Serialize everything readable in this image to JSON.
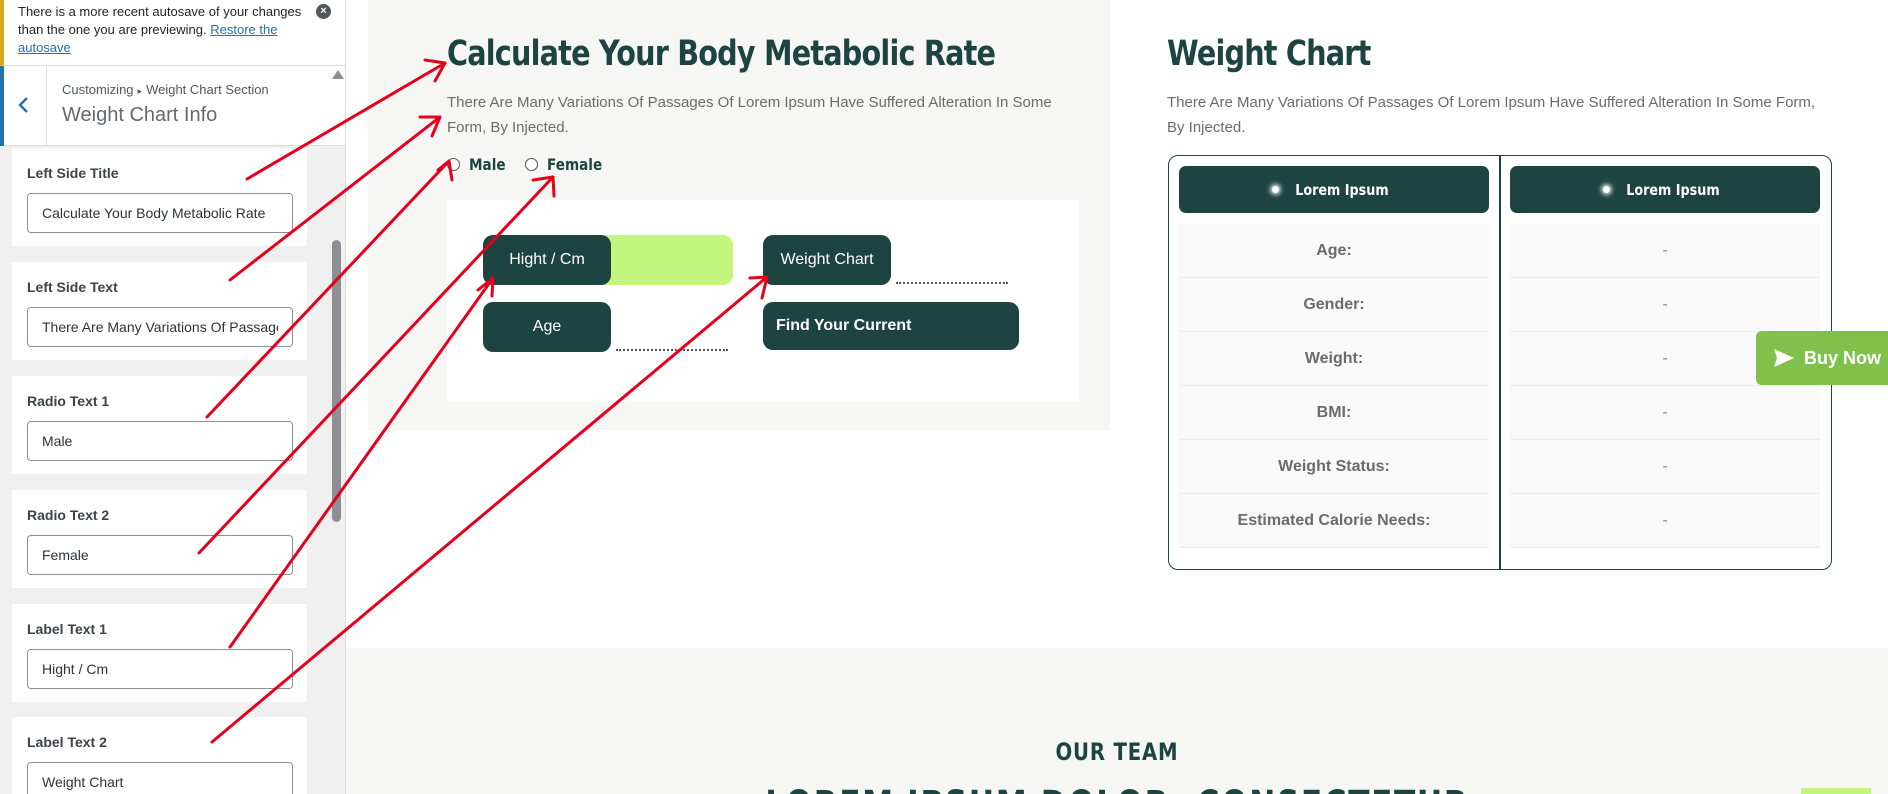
{
  "notice": {
    "text_before": "There is a more recent autosave of your changes than the one you are previewing.",
    "link": "Restore the autosave",
    "close_icon": "close-circle-icon"
  },
  "section": {
    "breadcrumb_root": "Customizing",
    "breadcrumb_sep": "▸",
    "breadcrumb_section": "Weight Chart Section",
    "title": "Weight Chart Info",
    "back_icon": "chevron-left-icon"
  },
  "controls": [
    {
      "label": "Left Side Title",
      "value": "Calculate Your Body Metabolic Rate"
    },
    {
      "label": "Left Side Text",
      "value": "There Are Many Variations Of Passages Of Lorem Ipsum"
    },
    {
      "label": "Radio Text 1",
      "value": "Male"
    },
    {
      "label": "Radio Text 2",
      "value": "Female"
    },
    {
      "label": "Label Text 1",
      "value": "Hight / Cm"
    },
    {
      "label": "Label Text 2",
      "value": "Weight Chart"
    }
  ],
  "calc": {
    "title": "Calculate Your Body Metabolic Rate",
    "text": "There Are Many Variations Of Passages Of Lorem Ipsum Have Suffered Alteration In Some Form, By Injected.",
    "radio1": "Male",
    "radio2": "Female",
    "label_height": "Hight / Cm",
    "label_weight": "Weight Chart",
    "label_age": "Age",
    "button": "Find Your Current"
  },
  "weight_chart": {
    "title": "Weight Chart",
    "text": "There Are Many Variations Of Passages Of Lorem Ipsum Have Suffered Alteration In Some Form, By Injected.",
    "col1_header": "Lorem Ipsum",
    "col2_header": "Lorem Ipsum",
    "rows": [
      {
        "label": "Age:",
        "value": "-"
      },
      {
        "label": "Gender:",
        "value": "-"
      },
      {
        "label": "Weight:",
        "value": "-"
      },
      {
        "label": "BMI:",
        "value": "-"
      },
      {
        "label": "Weight Status:",
        "value": "-"
      },
      {
        "label": "Estimated Calorie Needs:",
        "value": "-"
      }
    ]
  },
  "buy_now": {
    "label": "Buy Now",
    "icon": "paper-plane-icon"
  },
  "team": {
    "label": "OUR TEAM",
    "heading": "LOREM IPSUM DOLOR, CONSECTETUR"
  },
  "colors": {
    "brand_dark": "#1e4441",
    "brand_lime": "#c1f57e",
    "buy_green": "#7fc14a",
    "annotation_red": "#e5001c",
    "notice_border": "#dba617",
    "wp_blue": "#2271b1"
  }
}
